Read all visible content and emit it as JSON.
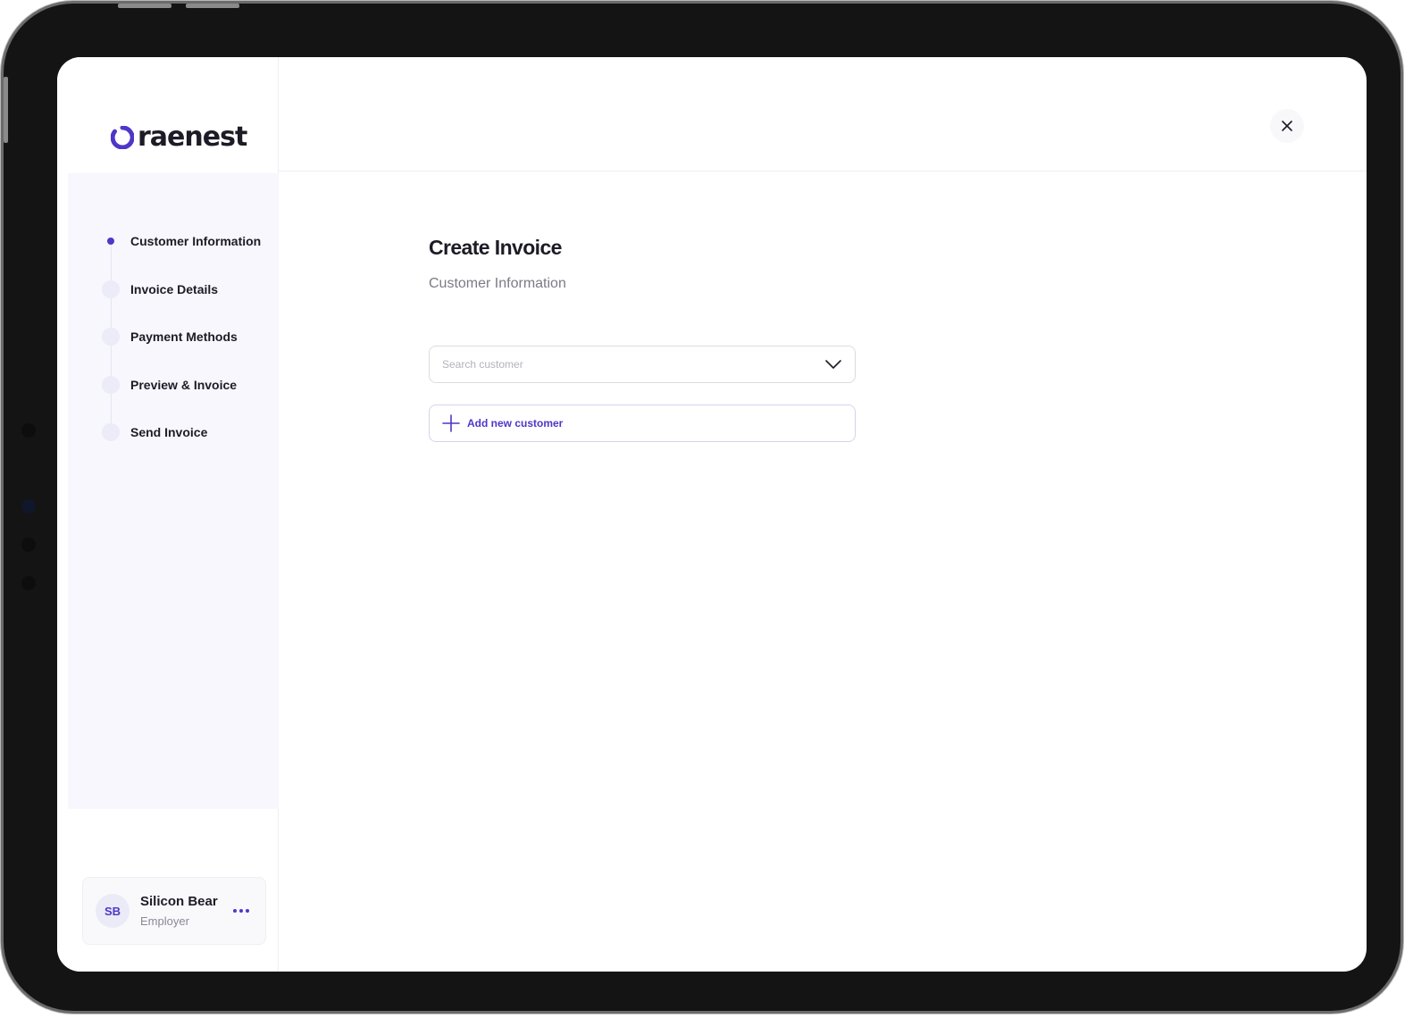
{
  "brand": {
    "name": "raenest",
    "accent": "#4f36c9"
  },
  "steps": [
    {
      "label": "Customer Information",
      "active": true
    },
    {
      "label": "Invoice Details",
      "active": false
    },
    {
      "label": "Payment Methods",
      "active": false
    },
    {
      "label": "Preview & Invoice",
      "active": false
    },
    {
      "label": "Send Invoice",
      "active": false
    }
  ],
  "main": {
    "title": "Create Invoice",
    "subtitle": "Customer Information",
    "search": {
      "placeholder": "Search customer",
      "value": ""
    },
    "add_customer_label": "Add new customer"
  },
  "user": {
    "initials": "SB",
    "name": "Silicon Bear",
    "role": "Employer"
  },
  "icons": {
    "close": "close-icon",
    "dropdown": "chevron-down-icon",
    "add": "plus-icon",
    "more": "more-horizontal-icon"
  }
}
